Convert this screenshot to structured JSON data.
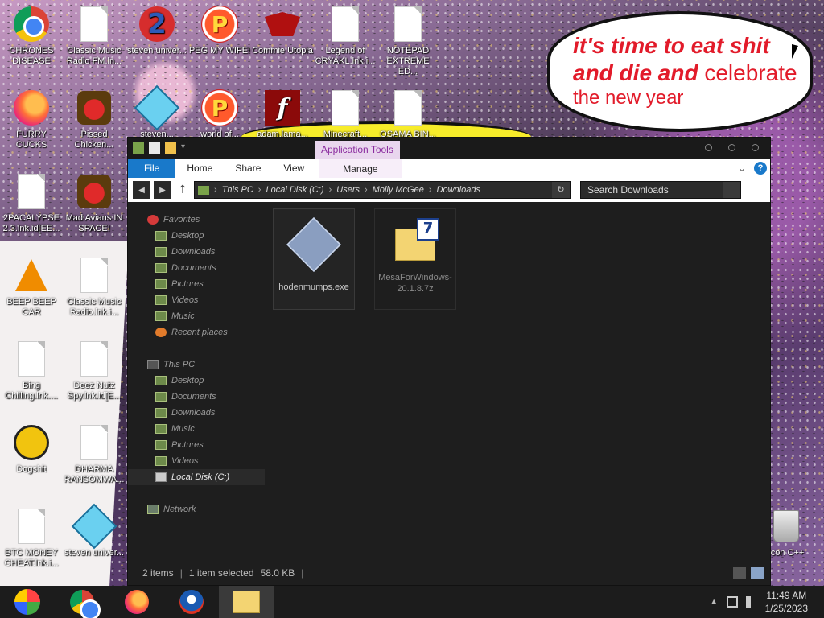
{
  "wallpaper": {
    "speech_line1": "it's time to eat shit",
    "speech_line2_bold": "and die and",
    "speech_line2_light": "celebrate",
    "speech_line3": "the new year"
  },
  "desktop_icons": [
    {
      "label": "CHRONES DISEASE",
      "icon": "chrome-icon"
    },
    {
      "label": "Classic Music Radio FM.ln...",
      "icon": "document-icon"
    },
    {
      "label": "steven univer...",
      "icon": "two-badge-icon"
    },
    {
      "label": "PEG MY WIFE!",
      "icon": "p-ball-icon"
    },
    {
      "label": "Commie Utopia",
      "icon": "commie-icon"
    },
    {
      "label": "Legend of CRYAKL.lnk.i...",
      "icon": "document-icon"
    },
    {
      "label": "NOTEPAD EXTREME ED...",
      "icon": "document-icon"
    },
    {
      "label": "FURRY CUCKS",
      "icon": "firefox-icon"
    },
    {
      "label": "Pissed Chicken...",
      "icon": "angry-bird-icon"
    },
    {
      "label": "steven...",
      "icon": "gem-icon"
    },
    {
      "label": "world of...",
      "icon": "p-ball-icon"
    },
    {
      "label": "adam.lama...",
      "icon": "flash-icon"
    },
    {
      "label": "Minecraft...",
      "icon": "document-icon"
    },
    {
      "label": "OSAMA BIN...",
      "icon": "document-icon"
    },
    {
      "label": "2PACALYPSE 2.3.lnk.id[EE...",
      "icon": "document-icon"
    },
    {
      "label": "Mad Avians IN SPACE!",
      "icon": "angry-bird-icon"
    },
    {
      "label": "BEEP BEEP CAR",
      "icon": "vlc-icon"
    },
    {
      "label": "Classic Music Radio.lnk.i...",
      "icon": "document-icon"
    },
    {
      "label": "Bing Chilling.lnk....",
      "icon": "document-icon"
    },
    {
      "label": "Deez Nutz Spy.lnk.id[E...",
      "icon": "document-icon"
    },
    {
      "label": "Dogshit",
      "icon": "dogshit-icon"
    },
    {
      "label": "DHARMA RANSOMWA...",
      "icon": "document-icon"
    },
    {
      "label": "BTC MONEY CHEAT.lnk.i...",
      "icon": "document-icon"
    },
    {
      "label": "steven univer...",
      "icon": "gem-icon"
    },
    {
      "label": "Icon C++",
      "icon": "recycle-bin-icon"
    }
  ],
  "explorer": {
    "context_tab": "Application Tools",
    "ribbon_tabs": [
      "File",
      "Home",
      "Share",
      "View"
    ],
    "manage_tab": "Manage",
    "address": [
      "This PC",
      "Local Disk (C:)",
      "Users",
      "Molly McGee",
      "Downloads"
    ],
    "search_placeholder": "Search Downloads",
    "nav": {
      "favorites": "Favorites",
      "fav_items": [
        "Desktop",
        "Downloads",
        "Documents",
        "Pictures",
        "Videos",
        "Music",
        "Recent places"
      ],
      "this_pc": "This PC",
      "pc_items": [
        "Desktop",
        "Documents",
        "Downloads",
        "Music",
        "Pictures",
        "Videos",
        "Local Disk (C:)"
      ],
      "network": "Network"
    },
    "files": [
      {
        "name": "hodenmumps.exe",
        "selected": true
      },
      {
        "name": "MesaForWindows-20.1.8.7z",
        "selected": false
      }
    ],
    "status": {
      "items": "2 items",
      "selected": "1 item selected",
      "size": "58.0 KB"
    }
  },
  "taskbar": {
    "time": "11:49 AM",
    "date": "1/25/2023"
  }
}
